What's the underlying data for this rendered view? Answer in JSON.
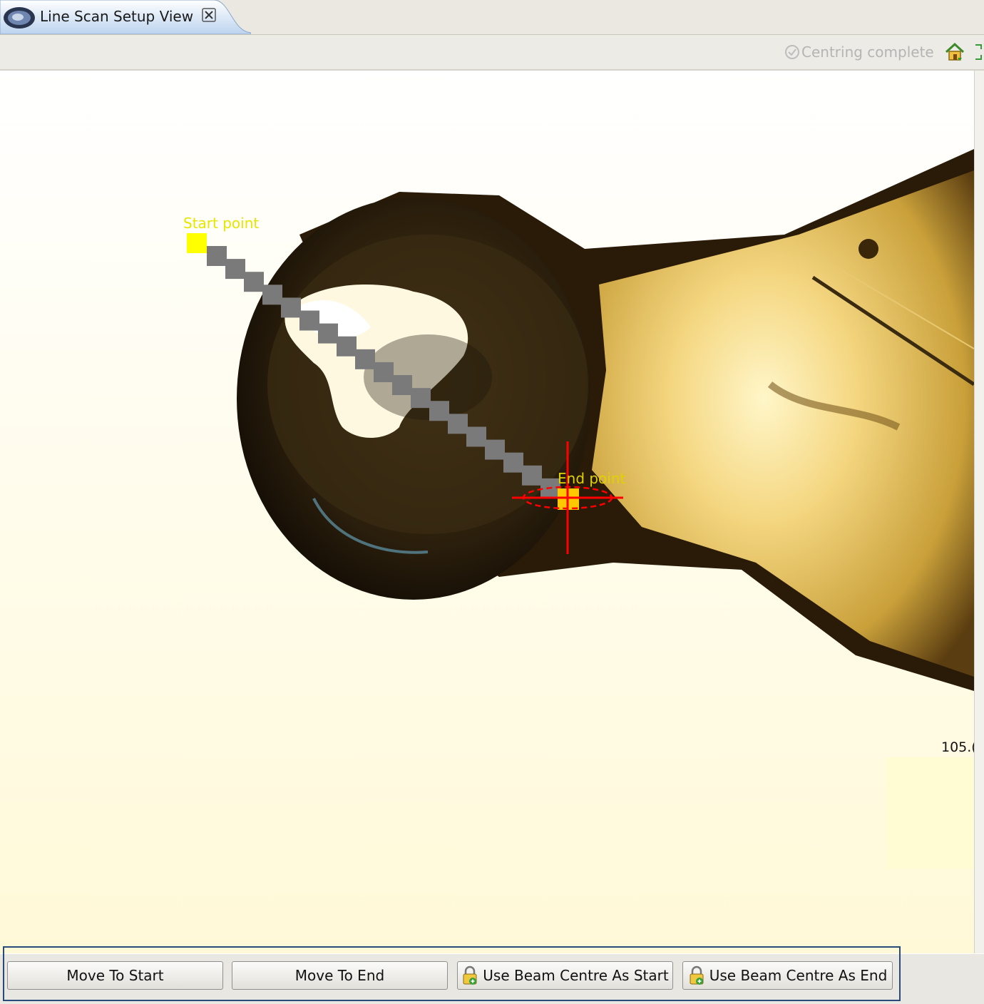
{
  "tab": {
    "title": "Line Scan Setup View"
  },
  "toolbar": {
    "status_text": "Centring complete",
    "status_icon": "check-circle-icon",
    "home_icon": "home-icon",
    "maximize_icon": "maximize-icon"
  },
  "camera": {
    "start_label": "Start point",
    "end_label": "End point",
    "scale_label": "105.(",
    "start_marker_color": "#ffff00",
    "end_marker_color": "#ffc800",
    "line_color": "#7a7a7a",
    "crosshair_color": "#ff0000"
  },
  "buttons": {
    "move_to_start": "Move To Start",
    "move_to_end": "Move To End",
    "use_beam_centre_as_start": "Use Beam Centre As Start",
    "use_beam_centre_as_end": "Use Beam Centre As End"
  }
}
